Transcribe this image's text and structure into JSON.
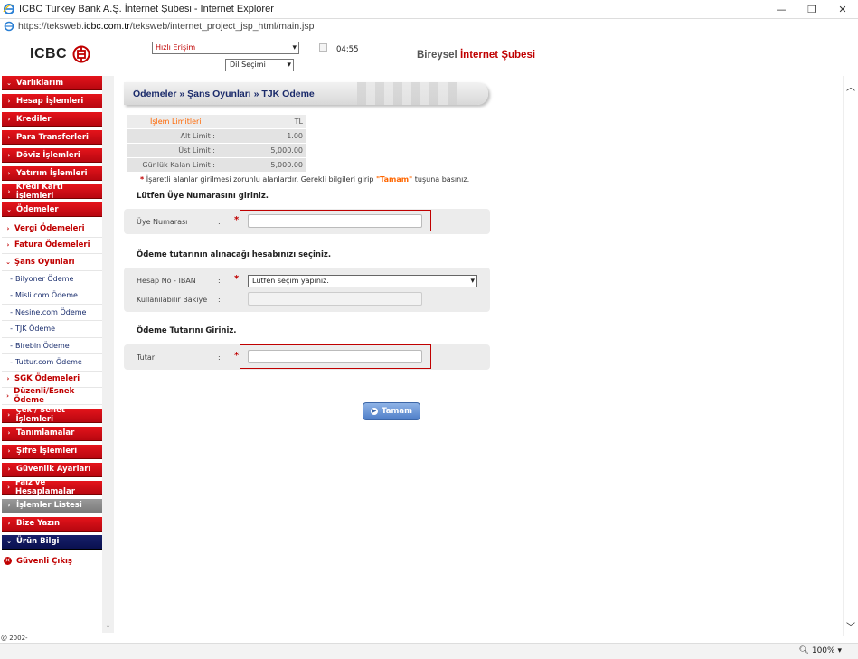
{
  "window": {
    "title": "ICBC Turkey Bank A.Ş. İnternet Şubesi - Internet Explorer",
    "url_prefix": "https://teksweb.",
    "url_host": "icbc.com.tr",
    "url_path": "/teksweb/internet_project_jsp_html/main.jsp",
    "minimize": "—",
    "restore": "❐",
    "close": "✕"
  },
  "header": {
    "logo_text": "ICBC",
    "quick_access": "Hızlı Erişim",
    "language": "Dil Seçimi",
    "timer": "04:55",
    "brand_prefix": "Bireysel",
    "brand_main": "İnternet Şubesi"
  },
  "sidebar": {
    "items": [
      {
        "label": "Varlıklarım",
        "chev": "⌄",
        "style": "red"
      },
      {
        "label": "Hesap İşlemleri",
        "chev": "›",
        "style": "red"
      },
      {
        "label": "Krediler",
        "chev": "›",
        "style": "red"
      },
      {
        "label": "Para Transferleri",
        "chev": "›",
        "style": "red"
      },
      {
        "label": "Döviz İşlemleri",
        "chev": "›",
        "style": "red"
      },
      {
        "label": "Yatırım İşlemleri",
        "chev": "›",
        "style": "red"
      },
      {
        "label": "Kredi Kartı İşlemleri",
        "chev": "›",
        "style": "red"
      },
      {
        "label": "Ödemeler",
        "chev": "⌄",
        "style": "red"
      }
    ],
    "sub_items_a": [
      {
        "label": "Vergi Ödemeleri",
        "chev": "›"
      },
      {
        "label": "Fatura Ödemeleri",
        "chev": "›"
      },
      {
        "label": "Şans Oyunları",
        "chev": "⌄"
      }
    ],
    "subsub_items": [
      "Bilyoner Ödeme",
      "Misli.com Ödeme",
      "Nesine.com Ödeme",
      "TJK Ödeme",
      "Birebin Ödeme",
      "Tuttur.com Ödeme"
    ],
    "sub_items_b": [
      {
        "label": "SGK Ödemeleri",
        "chev": "›"
      },
      {
        "label": "Düzenli/Esnek Ödeme",
        "chev": "›"
      }
    ],
    "items_b": [
      {
        "label": "Çek / Senet İşlemleri",
        "chev": "›",
        "style": "red"
      },
      {
        "label": "Tanımlamalar",
        "chev": "›",
        "style": "red"
      },
      {
        "label": "Şifre İşlemleri",
        "chev": "›",
        "style": "red"
      },
      {
        "label": "Güvenlik Ayarları",
        "chev": "›",
        "style": "red"
      },
      {
        "label": "Faiz ve Hesaplamalar",
        "chev": "›",
        "style": "red"
      },
      {
        "label": "İşlemler Listesi",
        "chev": "›",
        "style": "grey"
      },
      {
        "label": "Bize Yazın",
        "chev": "›",
        "style": "red"
      },
      {
        "label": "Ürün Bilgi",
        "chev": "⌄",
        "style": "navy"
      }
    ],
    "logout": "Güvenli Çıkış",
    "copyright": "@ 2002-"
  },
  "breadcrumb": "Ödemeler » Şans Oyunları » TJK Ödeme",
  "limits": {
    "header_label": "İşlem Limitleri",
    "header_value": "TL",
    "rows": [
      {
        "label": "Alt Limit :",
        "value": "1.00"
      },
      {
        "label": "Üst Limit :",
        "value": "5,000.00"
      },
      {
        "label": "Günlük Kalan Limit :",
        "value": "5,000.00"
      }
    ]
  },
  "notice": {
    "star": "*",
    "text_a": "İşaretli alanlar girilmesi zorunlu alanlardır. Gerekli bilgileri girip",
    "highlight": "\"Tamam\"",
    "text_b": "tuşuna basınız."
  },
  "sections": {
    "member_title": "Lütfen Üye Numarasını giriniz.",
    "member_label": "Üye Numarası",
    "account_title": "Ödeme tutarının alınacağı hesabınızı seçiniz.",
    "account_label": "Hesap No - IBAN",
    "account_placeholder": "Lütfen seçim yapınız.",
    "balance_label": "Kullanılabilir Bakiye",
    "amount_title": "Ödeme Tutarını Giriniz.",
    "amount_label": "Tutar",
    "colon": ":",
    "required": "*"
  },
  "button_ok": "Tamam",
  "statusbar": {
    "zoom": "100%"
  },
  "colors": {
    "brand_red": "#c00000",
    "navy": "#1a2a6a",
    "orange": "#ff6600"
  }
}
